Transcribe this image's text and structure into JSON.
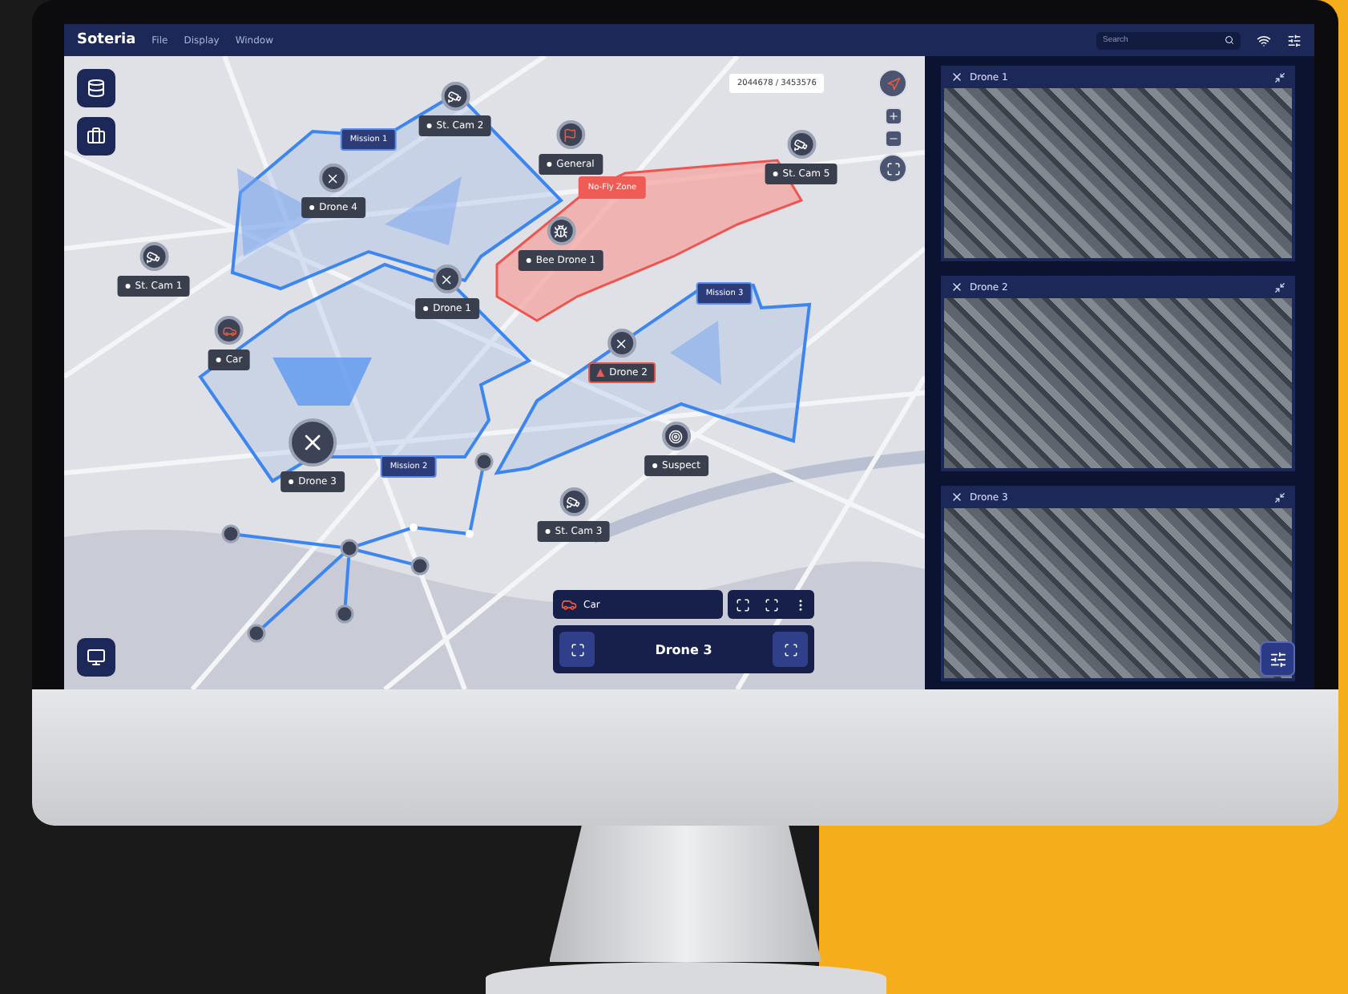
{
  "app": {
    "title": "Soteria",
    "menu": [
      "File",
      "Display",
      "Window"
    ],
    "search": {
      "placeholder": "Search"
    }
  },
  "map": {
    "coordinates": "2044678 / 3453576",
    "zones": [
      {
        "label": "Mission 1",
        "kind": "mission"
      },
      {
        "label": "No-Fly Zone",
        "kind": "nofly"
      },
      {
        "label": "Mission 3",
        "kind": "mission"
      },
      {
        "label": "Mission 2",
        "kind": "mission"
      }
    ],
    "markers": [
      {
        "label": "St. Cam 2",
        "kind": "camera",
        "alert": false
      },
      {
        "label": "General",
        "kind": "flag",
        "alert": false
      },
      {
        "label": "St. Cam 5",
        "kind": "camera",
        "alert": false
      },
      {
        "label": "Drone 4",
        "kind": "drone",
        "alert": false
      },
      {
        "label": "St. Cam 1",
        "kind": "camera",
        "alert": false
      },
      {
        "label": "Bee Drone 1",
        "kind": "bee",
        "alert": false
      },
      {
        "label": "Drone 1",
        "kind": "drone",
        "alert": false
      },
      {
        "label": "Car",
        "kind": "car",
        "alert": false
      },
      {
        "label": "Drone 2",
        "kind": "drone",
        "alert": true
      },
      {
        "label": "Drone 3",
        "kind": "drone",
        "alert": false
      },
      {
        "label": "Suspect",
        "kind": "target",
        "alert": false
      },
      {
        "label": "St. Cam 3",
        "kind": "camera",
        "alert": false
      }
    ]
  },
  "selection": {
    "vehicle": "Car",
    "target": "Drone 3"
  },
  "feeds": [
    {
      "title": "Drone 1"
    },
    {
      "title": "Drone 2"
    },
    {
      "title": "Drone 3"
    }
  ]
}
